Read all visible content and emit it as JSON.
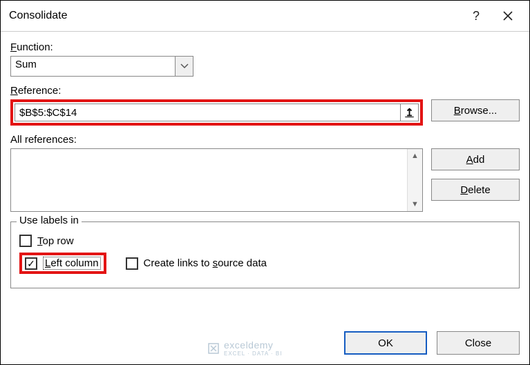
{
  "title": "Consolidate",
  "labels": {
    "function": "Function:",
    "reference": "Reference:",
    "all_references": "All references:",
    "use_labels_in": "Use labels in"
  },
  "function": {
    "selected": "Sum"
  },
  "reference": {
    "value": "$B$5:$C$14"
  },
  "buttons": {
    "browse": "Browse...",
    "add": "Add",
    "delete": "Delete",
    "ok": "OK",
    "close": "Close"
  },
  "checks": {
    "top_row": "Top row",
    "left_column": "Left column",
    "create_links": "Create links to source data"
  },
  "watermark": {
    "brand": "exceldemy",
    "tagline": "EXCEL · DATA · BI"
  }
}
